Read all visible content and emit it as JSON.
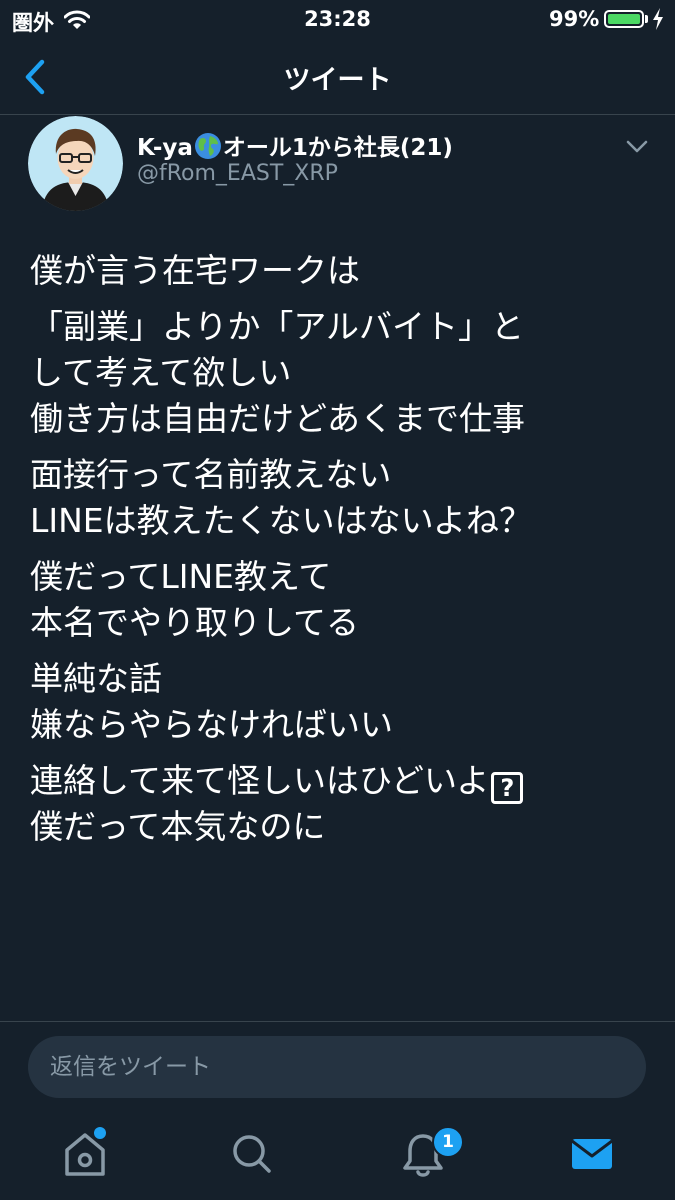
{
  "status_bar": {
    "carrier": "圏外",
    "time": "23:28",
    "battery_percent": "99%",
    "battery_level": 0.99
  },
  "nav": {
    "title": "ツイート",
    "back_icon": "chevron-left-icon"
  },
  "tweet": {
    "author_name_before": "K-ya",
    "author_name_emoji": "globe-icon",
    "author_name_after": "オール1から社長(21)",
    "author_handle": "@fRom_EAST_XRP",
    "paragraphs": [
      [
        "僕が言う在宅ワークは"
      ],
      [
        "「副業」よりか「アルバイト」と",
        "して考えて欲しい",
        "働き方は自由だけどあくまで仕事"
      ],
      [
        "面接行って名前教えない",
        "LINEは教えたくないはないよね？"
      ],
      [
        "僕だってLINE教えて",
        "本名でやり取りしてる"
      ],
      [
        "単純な話",
        "嫌ならやらなければいい"
      ],
      [
        "連絡して来て怪しいはひどいよ",
        "僕だって本気なのに"
      ]
    ],
    "unsupported_glyph": "?"
  },
  "reply": {
    "placeholder": "返信をツイート"
  },
  "tabs": {
    "notification_badge": "1"
  },
  "colors": {
    "background": "#15202b",
    "accent": "#1da1f2",
    "secondary_text": "#8899a6",
    "divider": "#38444d",
    "battery": "#4cd964"
  }
}
